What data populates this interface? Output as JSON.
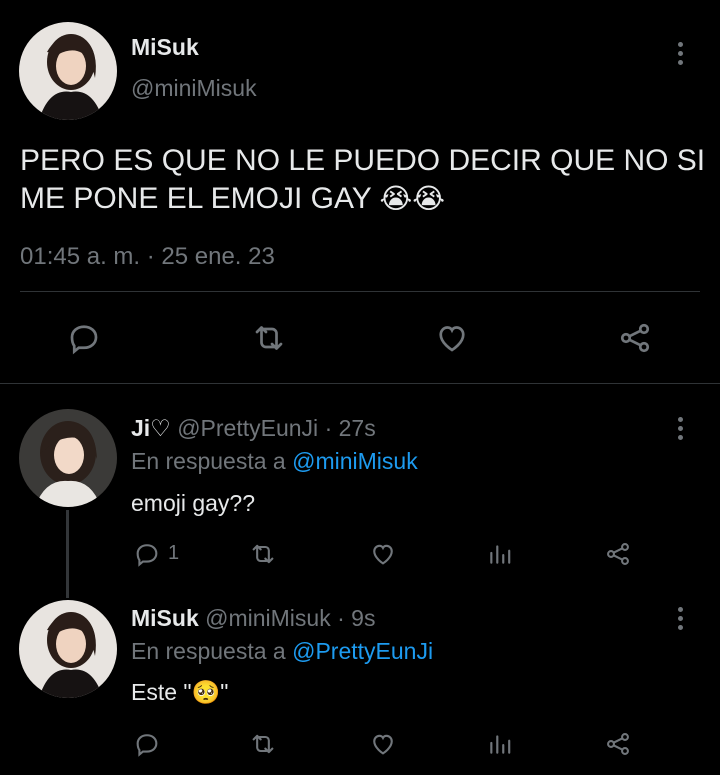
{
  "main_tweet": {
    "display_name": "MiSuk",
    "handle": "@miniMisuk",
    "text": "PERO ES QUE NO LE PUEDO DECIR QUE NO SI ME PONE EL EMOJI GAY",
    "emojis": "😭😭",
    "timestamp": "01:45 a. m. · 25 ene. 23"
  },
  "replies": [
    {
      "display_name": "Ji♡",
      "handle": "@PrettyEunJi",
      "time": "· 27s",
      "reply_prefix": "En respuesta a",
      "reply_to": "@miniMisuk",
      "text": "emoji gay??",
      "reply_count": "1"
    },
    {
      "display_name": "MiSuk",
      "handle": "@miniMisuk",
      "time": "· 9s",
      "reply_prefix": "En respuesta a",
      "reply_to": "@PrettyEunJi",
      "text": "Este \"🥺\""
    }
  ],
  "icons": {
    "reply": "reply-icon",
    "retweet": "retweet-icon",
    "like": "heart-icon",
    "analytics": "analytics-icon",
    "share": "share-icon",
    "more": "more-options-icon"
  },
  "colors": {
    "background": "#000000",
    "text": "#e7e9ea",
    "muted": "#71767b",
    "link": "#1d9bf0",
    "divider": "#2f3336"
  }
}
